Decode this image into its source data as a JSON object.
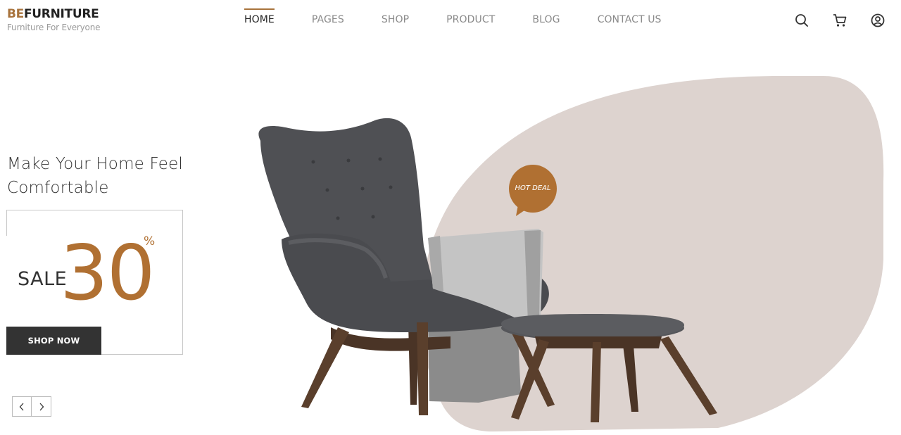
{
  "brand": {
    "prefix": "BE",
    "name": "FURNITURE",
    "tagline": "Furniture For Everyone",
    "accent_color": "#a8733c"
  },
  "nav": {
    "items": [
      {
        "label": "HOME",
        "active": true
      },
      {
        "label": "PAGES",
        "active": false
      },
      {
        "label": "SHOP",
        "active": false
      },
      {
        "label": "PRODUCT",
        "active": false
      },
      {
        "label": "BLOG",
        "active": false
      },
      {
        "label": "CONTACT US",
        "active": false
      }
    ]
  },
  "header_icons": [
    "search-icon",
    "cart-icon",
    "user-icon"
  ],
  "hero": {
    "headline_line1": "Make Your Home Feel",
    "headline_line2": "Comfortable",
    "sale_word": "SALE",
    "sale_number": "30",
    "sale_percent": "%",
    "cta_label": "SHOP NOW",
    "badge_text": "HOT DEAL",
    "prev_icon": "chevron-left-icon",
    "next_icon": "chevron-right-icon",
    "blob_color": "#ddd3cf",
    "badge_color": "#b07032"
  }
}
